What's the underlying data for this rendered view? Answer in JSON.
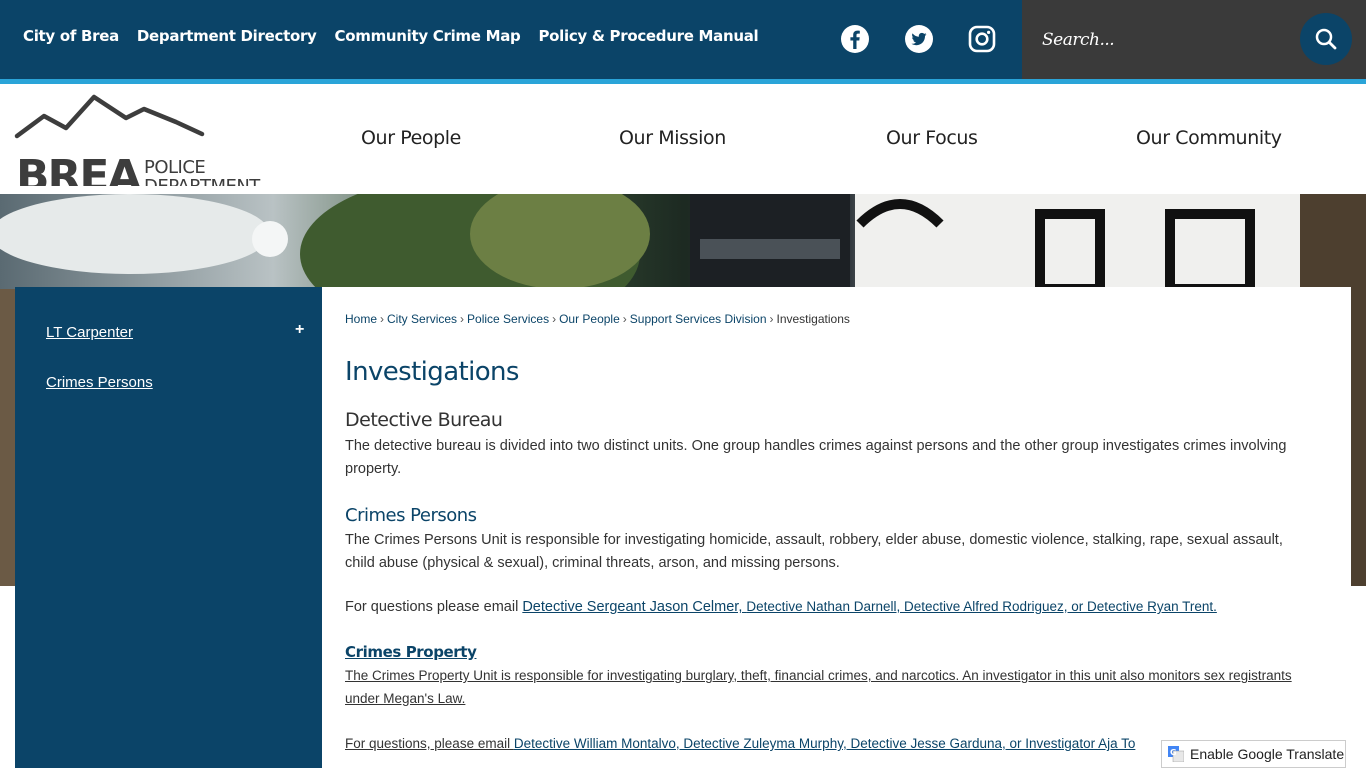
{
  "topbar": {
    "links": [
      "City of Brea",
      "Department Directory",
      "Community Crime Map",
      "Policy & Procedure Manual"
    ],
    "social": [
      "facebook-icon",
      "twitter-icon",
      "instagram-icon"
    ],
    "search_placeholder": "Search..."
  },
  "header": {
    "logo_brand": "BREA",
    "logo_line1": "POLICE",
    "logo_line2": "DEPARTMENT",
    "nav": [
      "Our People",
      "Our Mission",
      "Our Focus",
      "Our Community"
    ]
  },
  "sidebar": {
    "items": [
      {
        "label": "LT Carpenter",
        "expand": "+"
      },
      {
        "label": "Crimes Persons"
      }
    ]
  },
  "breadcrumb": {
    "items": [
      "Home",
      "City Services",
      "Police Services",
      "Our People",
      "Support Services Division"
    ],
    "current": "Investigations",
    "sep": "›"
  },
  "main": {
    "title": "Investigations",
    "bureau_heading": "Detective Bureau",
    "bureau_text": "The detective bureau is divided into two distinct units. One group handles crimes against persons and the other group investigates crimes involving property.",
    "persons_heading": "Crimes Persons",
    "persons_text": "The Crimes Persons Unit is responsible for investigating homicide, assault, robbery, elder abuse, domestic violence, stalking, rape, sexual assault, child abuse (physical & sexual), criminal threats, arson, and missing persons.",
    "persons_contact_prefix": "For questions please email ",
    "persons_contact_link1": "Detective Sergeant Jason Celmer, ",
    "persons_contact_link2": "Detective Nathan Darnell, Detective Alfred Rodriguez, or Detective Ryan Trent.",
    "property_heading": "Crimes Property",
    "property_text": "The Crimes Property Unit is responsible for investigating burglary, theft, financial crimes, and narcotics. An investigator in this unit also monitors sex registrants under Megan's Law.",
    "property_contact_prefix": "For questions, please email ",
    "property_contact_link": "Detective William Montalvo, Detective Zuleyma Murphy, Detective Jesse Garduna, or Investigator Aja To"
  },
  "translate": {
    "label": "Enable Google Translate"
  },
  "colors": {
    "navy": "#0b4468",
    "accent_stripe": "#2aa4d8",
    "search_bg": "#3a3a3a"
  }
}
